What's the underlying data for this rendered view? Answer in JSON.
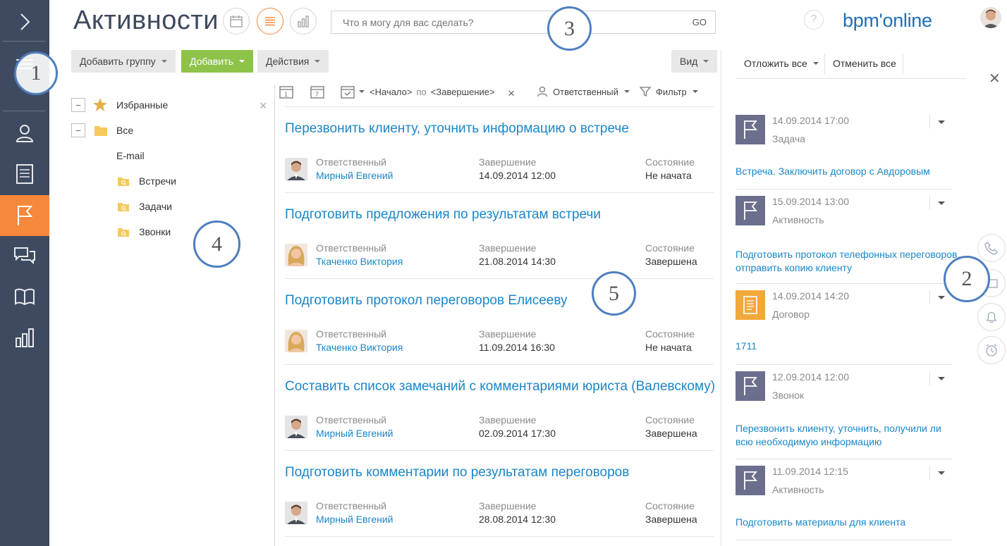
{
  "header": {
    "title": "Активности",
    "search_placeholder": "Что я могу для вас сделать?",
    "search_go": "GO",
    "help": "?",
    "logo": "bpm'online"
  },
  "toolbar": {
    "add_group": "Добавить группу",
    "add": "Добавить",
    "actions": "Действия",
    "view": "Вид"
  },
  "folders": {
    "favorites": "Избранные",
    "all": "Все",
    "email": "E-mail",
    "meetings": "Встречи",
    "tasks": "Задачи",
    "calls": "Звонки"
  },
  "filter": {
    "start": "<Начало>",
    "by": "по",
    "end": "<Завершение>",
    "owner": "Ответственный",
    "filter": "Фильтр"
  },
  "activities": [
    {
      "title": "Перезвонить клиенту, уточнить информацию о встрече",
      "owner_label": "Ответственный",
      "owner": "Мирный Евгений",
      "due_label": "Завершение",
      "due": "14.09.2014 12:00",
      "status_label": "Состояние",
      "status": "Не начата",
      "photo": "male"
    },
    {
      "title": "Подготовить предложения по результатам встречи",
      "owner_label": "Ответственный",
      "owner": "Ткаченко Виктория",
      "due_label": "Завершение",
      "due": "21.08.2014 14:30",
      "status_label": "Состояние",
      "status": "Завершена",
      "photo": "female"
    },
    {
      "title": "Подготовить протокол переговоров Елисееву",
      "owner_label": "Ответственный",
      "owner": "Ткаченко Виктория",
      "due_label": "Завершение",
      "due": "11.09.2014 16:30",
      "status_label": "Состояние",
      "status": "Не начата",
      "photo": "female"
    },
    {
      "title": "Составить список замечаний с комментариями юриста (Валевскому)",
      "owner_label": "Ответственный",
      "owner": "Мирный Евгений",
      "due_label": "Завершение",
      "due": "02.09.2014 17:30",
      "status_label": "Состояние",
      "status": "Завершена",
      "photo": "male"
    },
    {
      "title": "Подготовить комментарии по результатам переговоров",
      "owner_label": "Ответственный",
      "owner": "Мирный Евгений",
      "due_label": "Завершение",
      "due": "28.08.2014 12:30",
      "status_label": "Состояние",
      "status": "Завершена",
      "photo": "male"
    }
  ],
  "right_panel": {
    "postpone_all": "Отложить все",
    "cancel_all": "Отменить все",
    "notifications": [
      {
        "date": "14.09.2014 17:00",
        "type": "Задача",
        "link": "Встреча. Заключить договор с Авдоровым",
        "icon": "flag-icon"
      },
      {
        "date": "15.09.2014 13:00",
        "type": "Активность",
        "link": "Подготовить протокол телефонных переговоров, отправить копию клиенту",
        "icon": "flag-icon"
      },
      {
        "date": "14.09.2014 14:20",
        "type": "Договор",
        "link": "1711",
        "icon": "document-icon"
      },
      {
        "date": "12.09.2014 12:00",
        "type": "Звонок",
        "link": "Перезвонить клиенту, уточнить, получили ли всю необходимую информацию",
        "icon": "flag-icon"
      },
      {
        "date": "11.09.2014 12:15",
        "type": "Активность",
        "link": "Подготовить материалы для клиента",
        "icon": "flag-icon"
      }
    ]
  },
  "callouts": [
    "1",
    "2",
    "3",
    "4",
    "5"
  ],
  "colors": {
    "sidebar": "#3e4a5f",
    "accent": "#f6883b",
    "link": "#1a86c8",
    "add_button": "#8ec34a",
    "flag_icon_bg": "#6b6e8c",
    "document_icon_bg": "#f2a93b",
    "callout_border": "#4e7fbf"
  }
}
